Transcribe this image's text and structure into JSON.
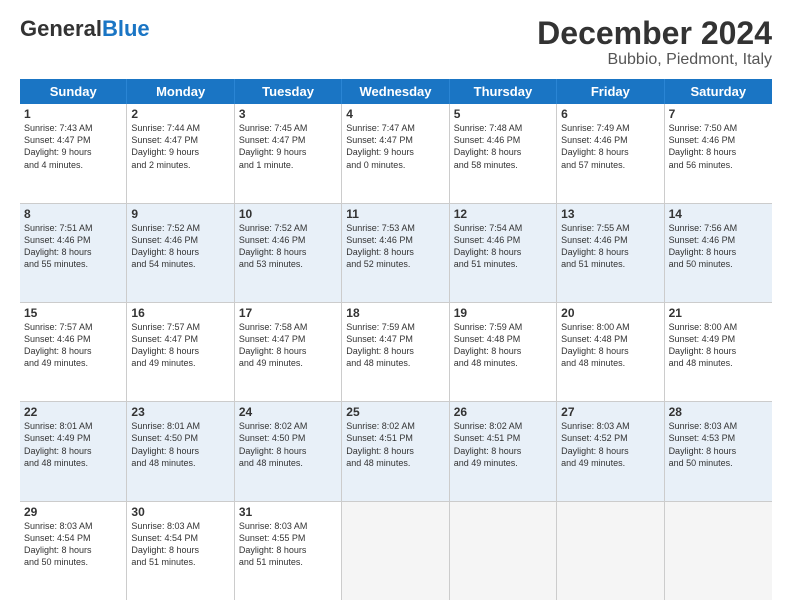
{
  "header": {
    "logo_general": "General",
    "logo_blue": "Blue",
    "title": "December 2024",
    "subtitle": "Bubbio, Piedmont, Italy"
  },
  "calendar": {
    "days": [
      "Sunday",
      "Monday",
      "Tuesday",
      "Wednesday",
      "Thursday",
      "Friday",
      "Saturday"
    ],
    "rows": [
      {
        "alt": false,
        "cells": [
          {
            "day": "1",
            "lines": [
              "Sunrise: 7:43 AM",
              "Sunset: 4:47 PM",
              "Daylight: 9 hours",
              "and 4 minutes."
            ]
          },
          {
            "day": "2",
            "lines": [
              "Sunrise: 7:44 AM",
              "Sunset: 4:47 PM",
              "Daylight: 9 hours",
              "and 2 minutes."
            ]
          },
          {
            "day": "3",
            "lines": [
              "Sunrise: 7:45 AM",
              "Sunset: 4:47 PM",
              "Daylight: 9 hours",
              "and 1 minute."
            ]
          },
          {
            "day": "4",
            "lines": [
              "Sunrise: 7:47 AM",
              "Sunset: 4:47 PM",
              "Daylight: 9 hours",
              "and 0 minutes."
            ]
          },
          {
            "day": "5",
            "lines": [
              "Sunrise: 7:48 AM",
              "Sunset: 4:46 PM",
              "Daylight: 8 hours",
              "and 58 minutes."
            ]
          },
          {
            "day": "6",
            "lines": [
              "Sunrise: 7:49 AM",
              "Sunset: 4:46 PM",
              "Daylight: 8 hours",
              "and 57 minutes."
            ]
          },
          {
            "day": "7",
            "lines": [
              "Sunrise: 7:50 AM",
              "Sunset: 4:46 PM",
              "Daylight: 8 hours",
              "and 56 minutes."
            ]
          }
        ]
      },
      {
        "alt": true,
        "cells": [
          {
            "day": "8",
            "lines": [
              "Sunrise: 7:51 AM",
              "Sunset: 4:46 PM",
              "Daylight: 8 hours",
              "and 55 minutes."
            ]
          },
          {
            "day": "9",
            "lines": [
              "Sunrise: 7:52 AM",
              "Sunset: 4:46 PM",
              "Daylight: 8 hours",
              "and 54 minutes."
            ]
          },
          {
            "day": "10",
            "lines": [
              "Sunrise: 7:52 AM",
              "Sunset: 4:46 PM",
              "Daylight: 8 hours",
              "and 53 minutes."
            ]
          },
          {
            "day": "11",
            "lines": [
              "Sunrise: 7:53 AM",
              "Sunset: 4:46 PM",
              "Daylight: 8 hours",
              "and 52 minutes."
            ]
          },
          {
            "day": "12",
            "lines": [
              "Sunrise: 7:54 AM",
              "Sunset: 4:46 PM",
              "Daylight: 8 hours",
              "and 51 minutes."
            ]
          },
          {
            "day": "13",
            "lines": [
              "Sunrise: 7:55 AM",
              "Sunset: 4:46 PM",
              "Daylight: 8 hours",
              "and 51 minutes."
            ]
          },
          {
            "day": "14",
            "lines": [
              "Sunrise: 7:56 AM",
              "Sunset: 4:46 PM",
              "Daylight: 8 hours",
              "and 50 minutes."
            ]
          }
        ]
      },
      {
        "alt": false,
        "cells": [
          {
            "day": "15",
            "lines": [
              "Sunrise: 7:57 AM",
              "Sunset: 4:46 PM",
              "Daylight: 8 hours",
              "and 49 minutes."
            ]
          },
          {
            "day": "16",
            "lines": [
              "Sunrise: 7:57 AM",
              "Sunset: 4:47 PM",
              "Daylight: 8 hours",
              "and 49 minutes."
            ]
          },
          {
            "day": "17",
            "lines": [
              "Sunrise: 7:58 AM",
              "Sunset: 4:47 PM",
              "Daylight: 8 hours",
              "and 49 minutes."
            ]
          },
          {
            "day": "18",
            "lines": [
              "Sunrise: 7:59 AM",
              "Sunset: 4:47 PM",
              "Daylight: 8 hours",
              "and 48 minutes."
            ]
          },
          {
            "day": "19",
            "lines": [
              "Sunrise: 7:59 AM",
              "Sunset: 4:48 PM",
              "Daylight: 8 hours",
              "and 48 minutes."
            ]
          },
          {
            "day": "20",
            "lines": [
              "Sunrise: 8:00 AM",
              "Sunset: 4:48 PM",
              "Daylight: 8 hours",
              "and 48 minutes."
            ]
          },
          {
            "day": "21",
            "lines": [
              "Sunrise: 8:00 AM",
              "Sunset: 4:49 PM",
              "Daylight: 8 hours",
              "and 48 minutes."
            ]
          }
        ]
      },
      {
        "alt": true,
        "cells": [
          {
            "day": "22",
            "lines": [
              "Sunrise: 8:01 AM",
              "Sunset: 4:49 PM",
              "Daylight: 8 hours",
              "and 48 minutes."
            ]
          },
          {
            "day": "23",
            "lines": [
              "Sunrise: 8:01 AM",
              "Sunset: 4:50 PM",
              "Daylight: 8 hours",
              "and 48 minutes."
            ]
          },
          {
            "day": "24",
            "lines": [
              "Sunrise: 8:02 AM",
              "Sunset: 4:50 PM",
              "Daylight: 8 hours",
              "and 48 minutes."
            ]
          },
          {
            "day": "25",
            "lines": [
              "Sunrise: 8:02 AM",
              "Sunset: 4:51 PM",
              "Daylight: 8 hours",
              "and 48 minutes."
            ]
          },
          {
            "day": "26",
            "lines": [
              "Sunrise: 8:02 AM",
              "Sunset: 4:51 PM",
              "Daylight: 8 hours",
              "and 49 minutes."
            ]
          },
          {
            "day": "27",
            "lines": [
              "Sunrise: 8:03 AM",
              "Sunset: 4:52 PM",
              "Daylight: 8 hours",
              "and 49 minutes."
            ]
          },
          {
            "day": "28",
            "lines": [
              "Sunrise: 8:03 AM",
              "Sunset: 4:53 PM",
              "Daylight: 8 hours",
              "and 50 minutes."
            ]
          }
        ]
      },
      {
        "alt": false,
        "cells": [
          {
            "day": "29",
            "lines": [
              "Sunrise: 8:03 AM",
              "Sunset: 4:54 PM",
              "Daylight: 8 hours",
              "and 50 minutes."
            ]
          },
          {
            "day": "30",
            "lines": [
              "Sunrise: 8:03 AM",
              "Sunset: 4:54 PM",
              "Daylight: 8 hours",
              "and 51 minutes."
            ]
          },
          {
            "day": "31",
            "lines": [
              "Sunrise: 8:03 AM",
              "Sunset: 4:55 PM",
              "Daylight: 8 hours",
              "and 51 minutes."
            ]
          },
          {
            "day": "",
            "lines": []
          },
          {
            "day": "",
            "lines": []
          },
          {
            "day": "",
            "lines": []
          },
          {
            "day": "",
            "lines": []
          }
        ]
      }
    ]
  }
}
